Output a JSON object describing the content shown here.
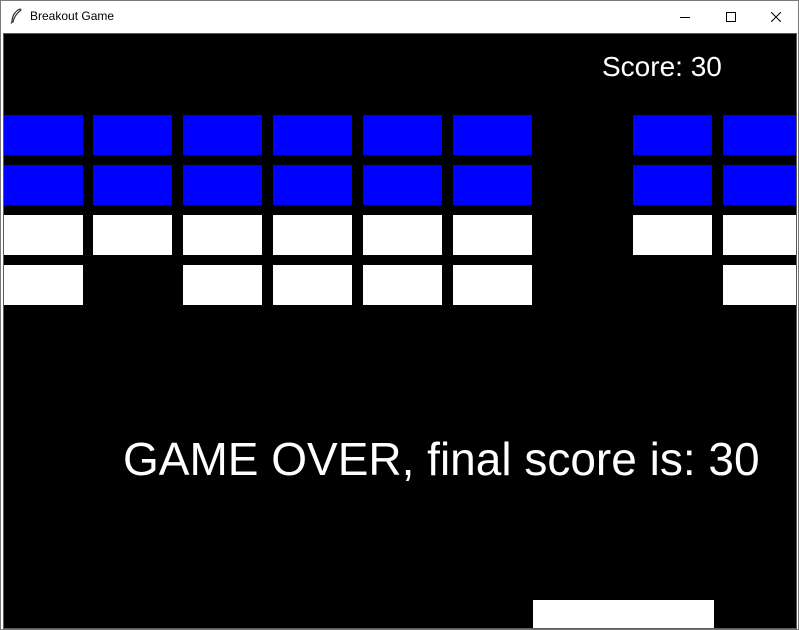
{
  "window": {
    "title": "Breakout Game",
    "controls": {
      "minimize_icon": "minimize-icon",
      "maximize_icon": "maximize-icon",
      "close_icon": "close-icon"
    }
  },
  "game": {
    "score_text": "Score: 30",
    "game_over_text": "GAME OVER, final score is: 30",
    "background_color": "#000000",
    "brick_rows": [
      {
        "color": "#0000ff",
        "bricks": [
          1,
          1,
          1,
          1,
          1,
          1,
          0,
          1,
          1
        ]
      },
      {
        "color": "#0000ff",
        "bricks": [
          1,
          1,
          1,
          1,
          1,
          1,
          0,
          1,
          1
        ]
      },
      {
        "color": "#ffffff",
        "bricks": [
          1,
          1,
          1,
          1,
          1,
          1,
          0,
          1,
          1
        ]
      },
      {
        "color": "#ffffff",
        "bricks": [
          1,
          0,
          1,
          1,
          1,
          1,
          0,
          0,
          1
        ]
      }
    ],
    "paddle_color": "#ffffff"
  }
}
